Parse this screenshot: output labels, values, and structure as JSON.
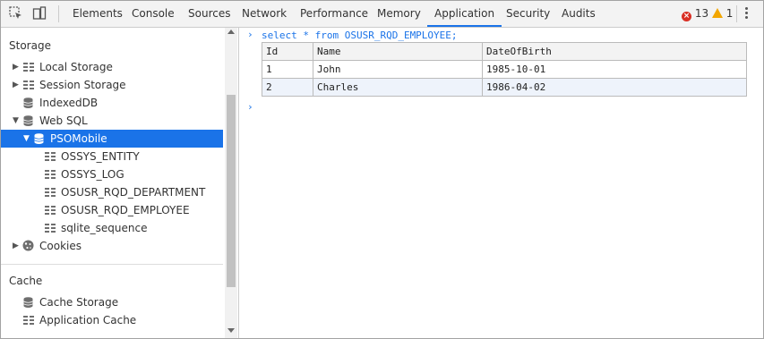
{
  "toolbar": {
    "tabs": [
      {
        "label": "Elements"
      },
      {
        "label": "Console"
      },
      {
        "label": "Sources"
      },
      {
        "label": "Network"
      },
      {
        "label": "Performance"
      },
      {
        "label": "Memory"
      },
      {
        "label": "Application"
      },
      {
        "label": "Security"
      },
      {
        "label": "Audits"
      }
    ],
    "active_tab": "Application",
    "error_count": "13",
    "warning_count": "1",
    "icons": [
      "inspect-element-icon",
      "device-toolbar-icon",
      "error-icon",
      "warning-icon",
      "more-options-icon"
    ]
  },
  "sidebar": {
    "storage_title": "Storage",
    "items": [
      {
        "label": "Local Storage"
      },
      {
        "label": "Session Storage"
      },
      {
        "label": "IndexedDB"
      },
      {
        "label": "Web SQL"
      },
      {
        "label": "PSOMobile"
      },
      {
        "label": "OSSYS_ENTITY"
      },
      {
        "label": "OSSYS_LOG"
      },
      {
        "label": "OSUSR_RQD_DEPARTMENT"
      },
      {
        "label": "OSUSR_RQD_EMPLOYEE"
      },
      {
        "label": "sqlite_sequence"
      },
      {
        "label": "Cookies"
      }
    ],
    "cache_title": "Cache",
    "cache_items": [
      {
        "label": "Cache Storage"
      },
      {
        "label": "Application Cache"
      }
    ]
  },
  "console": {
    "command": "select * from OSUSR_RQD_EMPLOYEE;",
    "prompt": "›",
    "table": {
      "headers": [
        "Id",
        "Name",
        "DateOfBirth"
      ],
      "rows": [
        [
          "1",
          "John",
          "1985-10-01"
        ],
        [
          "2",
          "Charles",
          "1986-04-02"
        ]
      ]
    }
  },
  "colors": {
    "accent": "#1a73e8",
    "error": "#d93025",
    "warning": "#f2a600"
  }
}
